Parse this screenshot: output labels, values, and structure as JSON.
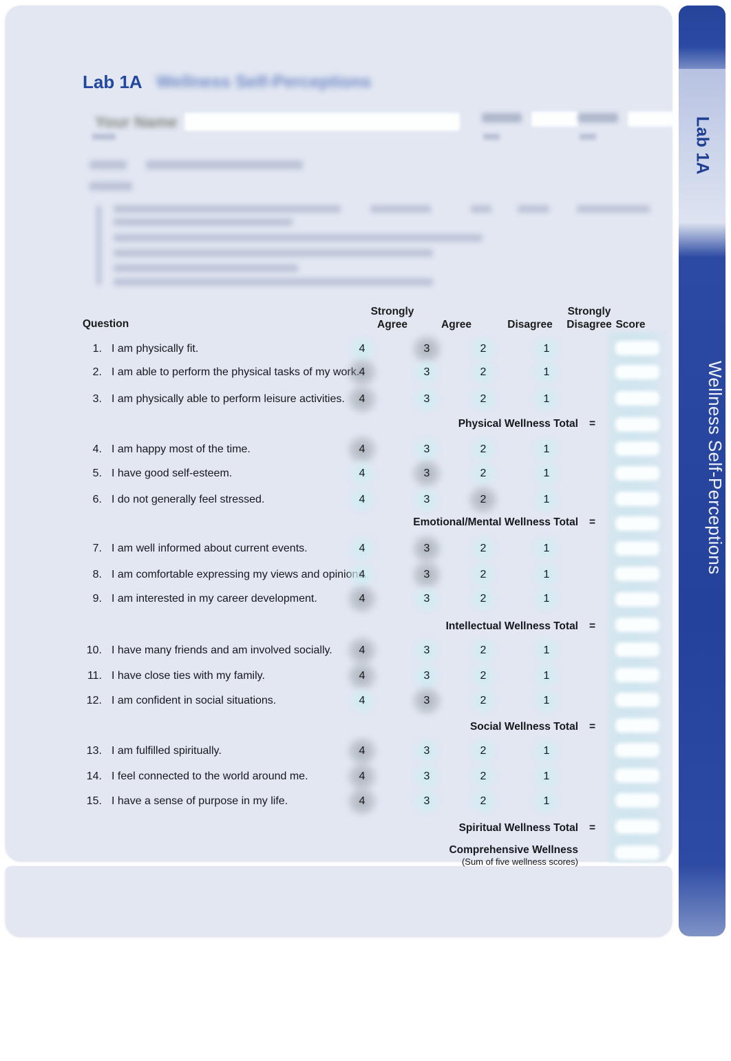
{
  "document": {
    "lab_code": "Lab 1A",
    "lab_title": "Wellness Self-Perceptions",
    "side_tab_lab": "Lab 1A",
    "side_tab_title": "Wellness Self-Perceptions"
  },
  "colors": {
    "page_bg": "#e2e7f2",
    "tab_dark_blue": "#24429a",
    "tab_light_blue": "#c4cee7",
    "heading_blue": "#22479e",
    "title_blue": "#5c78bd",
    "score_column": "#d3e6f0",
    "text": "#16181c"
  },
  "table": {
    "headers": {
      "question": "Question",
      "strongly_agree": "Strongly\nAgree",
      "strongly_agree_line1": "Strongly",
      "strongly_agree_line2": "Agree",
      "agree": "Agree",
      "disagree": "Disagree",
      "strongly_disagree_line1": "Strongly",
      "strongly_disagree_line2": "Disagree",
      "score": "Score"
    },
    "option_values": [
      "4",
      "3",
      "2",
      "1"
    ],
    "questions": [
      {
        "num": "1.",
        "text": "I am physically fit.",
        "selected": 3
      },
      {
        "num": "2.",
        "text": "I am able to perform the physical tasks of my work.",
        "selected": 4
      },
      {
        "num": "3.",
        "text": "I am physically able to perform leisure activities.",
        "selected": 4
      },
      {
        "num": "4.",
        "text": "I am happy most of the time.",
        "selected": 4
      },
      {
        "num": "5.",
        "text": "I have good self-esteem.",
        "selected": 3
      },
      {
        "num": "6.",
        "text": "I do not generally feel stressed.",
        "selected": 2
      },
      {
        "num": "7.",
        "text": "I am well informed about current events.",
        "selected": 3
      },
      {
        "num": "8.",
        "text": "I am comfortable expressing my views and opinions.",
        "selected": 3
      },
      {
        "num": "9.",
        "text": "I am interested in my career development.",
        "selected": 4
      },
      {
        "num": "10.",
        "text": "I have many friends and am involved socially.",
        "selected": 4
      },
      {
        "num": "11.",
        "text": "I have close ties with my family.",
        "selected": 4
      },
      {
        "num": "12.",
        "text": "I am confident in social situations.",
        "selected": 3
      },
      {
        "num": "13.",
        "text": "I am fulfilled spiritually.",
        "selected": 4
      },
      {
        "num": "14.",
        "text": "I feel connected to the world around me.",
        "selected": 4
      },
      {
        "num": "15.",
        "text": "I have a sense of purpose in my life.",
        "selected": 4
      }
    ],
    "totals": [
      {
        "label": "Physical Wellness  Total",
        "equals": "="
      },
      {
        "label": "Emotional/Mental Wellness  Total",
        "equals": "="
      },
      {
        "label": "Intellectual Wellness  Total",
        "equals": "="
      },
      {
        "label": "Social Wellness  Total",
        "equals": "="
      },
      {
        "label": "Spiritual Wellness Total",
        "equals": "="
      }
    ],
    "comprehensive": {
      "title": "Comprehensive Wellness",
      "subtitle": "(Sum of five wellness scores)"
    }
  }
}
